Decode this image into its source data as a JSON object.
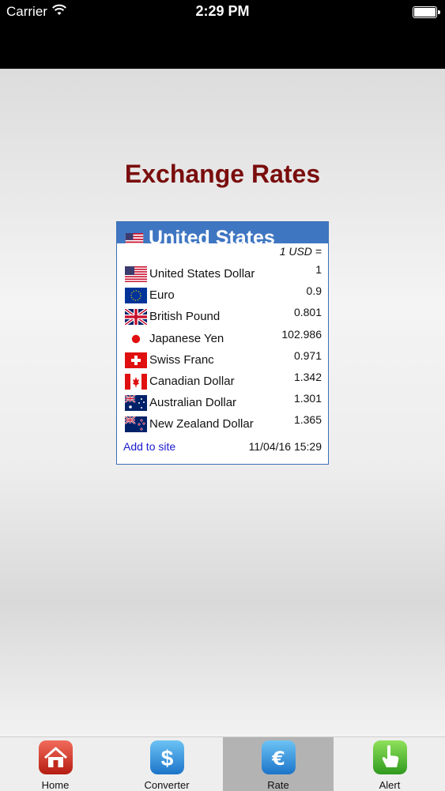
{
  "status_bar": {
    "carrier": "Carrier",
    "time": "2:29 PM"
  },
  "page": {
    "title": "Exchange Rates"
  },
  "widget": {
    "country": "United States",
    "base_label": "1 USD =",
    "rates": [
      {
        "currency": "United States Dollar",
        "rate": "1",
        "flag": "us-flag-icon"
      },
      {
        "currency": "Euro",
        "rate": "0.9",
        "flag": "eu-flag-icon"
      },
      {
        "currency": "British Pound",
        "rate": "0.801",
        "flag": "uk-flag-icon"
      },
      {
        "currency": "Japanese Yen",
        "rate": "102.986",
        "flag": "japan-flag-icon"
      },
      {
        "currency": "Swiss Franc",
        "rate": "0.971",
        "flag": "swiss-flag-icon"
      },
      {
        "currency": "Canadian Dollar",
        "rate": "1.342",
        "flag": "canada-flag-icon"
      },
      {
        "currency": "Australian Dollar",
        "rate": "1.301",
        "flag": "australia-flag-icon"
      },
      {
        "currency": "New Zealand Dollar",
        "rate": "1.365",
        "flag": "new-zealand-flag-icon"
      }
    ],
    "add_link": "Add to site",
    "timestamp": "11/04/16 15:29"
  },
  "tabbar": {
    "tabs": [
      {
        "label": "Home",
        "icon": "home-icon"
      },
      {
        "label": "Converter",
        "icon": "dollar-icon"
      },
      {
        "label": "Rate",
        "icon": "euro-icon",
        "selected": true
      },
      {
        "label": "Alert",
        "icon": "pointer-hand-icon"
      }
    ]
  },
  "colors": {
    "title": "#7a0d0d",
    "widget_header": "#3f76c2",
    "link": "#1a1acc"
  }
}
